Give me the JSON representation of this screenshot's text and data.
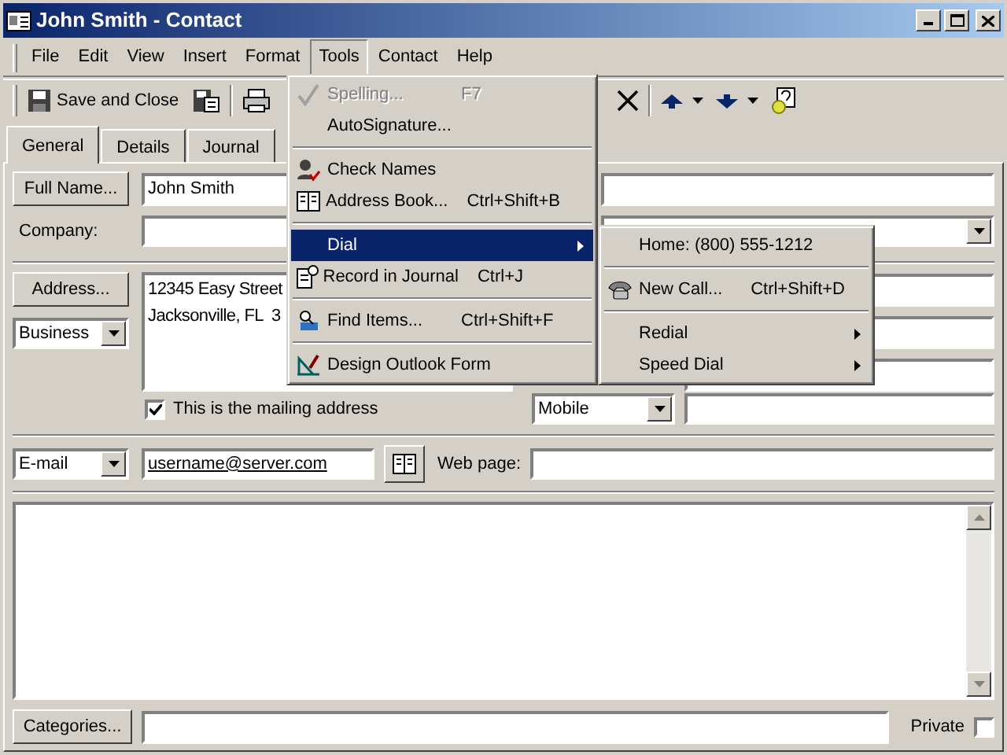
{
  "window": {
    "title": "John Smith - Contact"
  },
  "menu_bar": [
    {
      "label": "File",
      "selected": false
    },
    {
      "label": "Edit",
      "selected": false
    },
    {
      "label": "View",
      "selected": false
    },
    {
      "label": "Insert",
      "selected": false
    },
    {
      "label": "Format",
      "selected": false
    },
    {
      "label": "Tools",
      "selected": true
    },
    {
      "label": "Contact",
      "selected": false
    },
    {
      "label": "Help",
      "selected": false
    }
  ],
  "toolbar": {
    "save_and_close": "Save and Close"
  },
  "tabs": [
    {
      "label": "General",
      "selected": true
    },
    {
      "label": "Details",
      "selected": false
    },
    {
      "label": "Journal",
      "selected": false
    }
  ],
  "form": {
    "full_name_button": "Full Name...",
    "full_name": "John Smith",
    "company_label": "Company:",
    "address_button": "Address...",
    "address_lines": [
      "12345 Easy Street",
      "Jacksonville, FL  3"
    ],
    "address_type": "Business",
    "mailing_address": {
      "label": "This is the mailing address",
      "checked": true
    },
    "phone_type": "Mobile",
    "email_type": "E-mail",
    "email": "username@server.com",
    "web_page_label": "Web page:",
    "categories_button": "Categories...",
    "private": {
      "label": "Private",
      "checked": false
    }
  },
  "tools_menu": [
    {
      "kind": "item",
      "label": "Spelling...",
      "shortcut": "F7",
      "disabled": true,
      "selected": false
    },
    {
      "kind": "item",
      "label": "AutoSignature...",
      "disabled": false,
      "selected": false
    },
    {
      "kind": "separator"
    },
    {
      "kind": "item",
      "label": "Check Names",
      "disabled": false,
      "selected": false
    },
    {
      "kind": "item",
      "label": "Address Book...",
      "shortcut": "Ctrl+Shift+B",
      "disabled": false,
      "selected": false
    },
    {
      "kind": "separator"
    },
    {
      "kind": "submenu",
      "label": "Dial",
      "disabled": false,
      "selected": true
    },
    {
      "kind": "item",
      "label": "Record in Journal",
      "shortcut": "Ctrl+J",
      "disabled": false,
      "selected": false
    },
    {
      "kind": "separator"
    },
    {
      "kind": "item",
      "label": "Find Items...",
      "shortcut": "Ctrl+Shift+F",
      "disabled": false,
      "selected": false
    },
    {
      "kind": "separator"
    },
    {
      "kind": "item",
      "label": "Design Outlook Form",
      "disabled": false,
      "selected": false
    }
  ],
  "dial_menu": [
    {
      "kind": "item",
      "label": "Home: (800) 555-1212",
      "disabled": false,
      "selected": false
    },
    {
      "kind": "separator"
    },
    {
      "kind": "item",
      "label": "New Call...",
      "shortcut": "Ctrl+Shift+D",
      "disabled": false,
      "selected": false
    },
    {
      "kind": "separator"
    },
    {
      "kind": "submenu",
      "label": "Redial",
      "disabled": false,
      "selected": false
    },
    {
      "kind": "submenu",
      "label": "Speed Dial",
      "disabled": false,
      "selected": false
    }
  ]
}
